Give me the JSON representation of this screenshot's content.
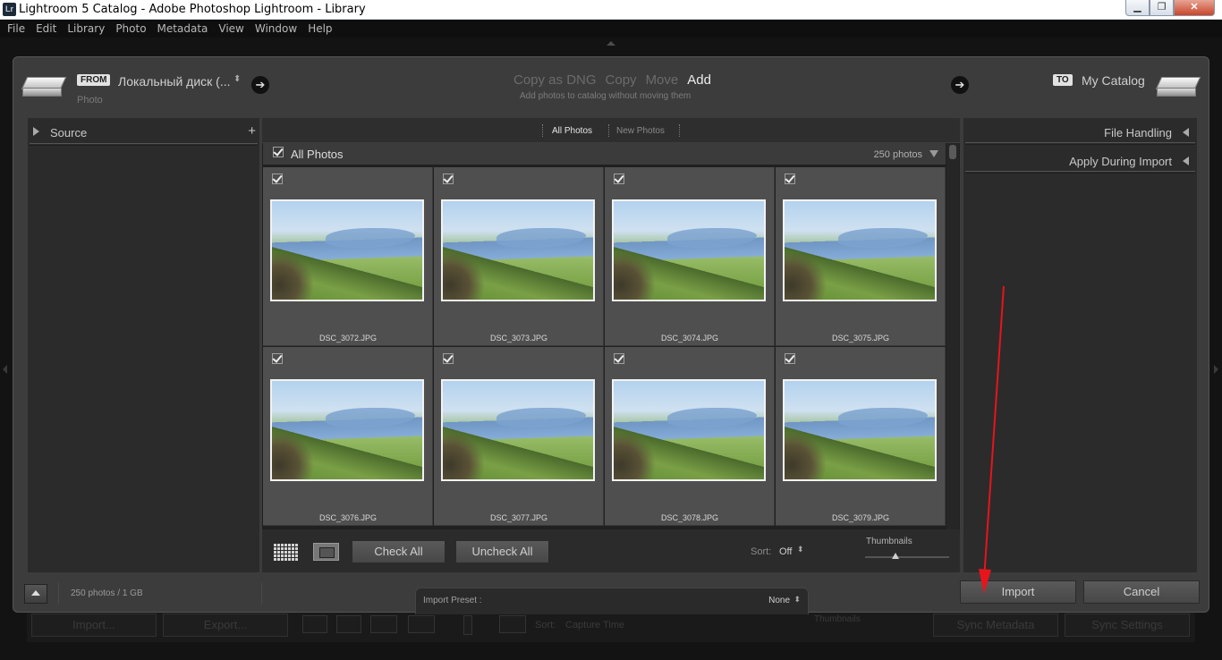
{
  "window": {
    "title": "Lightroom 5 Catalog - Adobe Photoshop Lightroom - Library",
    "app_icon": "Lr",
    "controls": {
      "minimize": "▁",
      "maximize": "❐",
      "close": "✕"
    }
  },
  "menu": [
    "File",
    "Edit",
    "Library",
    "Photo",
    "Metadata",
    "View",
    "Window",
    "Help"
  ],
  "import_dialog": {
    "source": {
      "tag": "FROM",
      "name": "Локальный диск (...",
      "subtitle": "Photo"
    },
    "modes": {
      "copy_as_dng": "Copy as DNG",
      "copy": "Copy",
      "move": "Move",
      "add": "Add",
      "active": "add"
    },
    "mode_description": "Add photos to catalog without moving them",
    "destination": {
      "tag": "TO",
      "name": "My Catalog"
    },
    "left_panel": {
      "source_label": "Source",
      "add_symbol": "+"
    },
    "right_panel": {
      "file_handling": "File Handling",
      "apply_during_import": "Apply During Import"
    },
    "filter": {
      "all_photos": "All Photos",
      "new_photos": "New Photos"
    },
    "grid_header": {
      "label": "All Photos",
      "count": "250 photos"
    },
    "photos": [
      {
        "file": "DSC_3072.JPG",
        "checked": true
      },
      {
        "file": "DSC_3073.JPG",
        "checked": true
      },
      {
        "file": "DSC_3074.JPG",
        "checked": true
      },
      {
        "file": "DSC_3075.JPG",
        "checked": true
      },
      {
        "file": "DSC_3076.JPG",
        "checked": true
      },
      {
        "file": "DSC_3077.JPG",
        "checked": true
      },
      {
        "file": "DSC_3078.JPG",
        "checked": true
      },
      {
        "file": "DSC_3079.JPG",
        "checked": true
      }
    ],
    "toolbar": {
      "check_all": "Check All",
      "uncheck_all": "Uncheck All",
      "sort_label": "Sort:",
      "sort_value": "Off",
      "sort_caret": "⬍",
      "thumbnails_label": "Thumbnails",
      "thumbnail_size": 0.36
    },
    "footer": {
      "info": "250 photos / 1 GB",
      "import_preset_label": "Import Preset :",
      "import_preset_value": "None",
      "preset_caret": "⬍",
      "import_button": "Import",
      "cancel_button": "Cancel"
    }
  },
  "background_bar": {
    "import": "Import...",
    "export": "Export...",
    "sort_label": "Sort:",
    "sort_value": "Capture Time",
    "thumbnails": "Thumbnails",
    "sync_metadata": "Sync Metadata",
    "sync_settings": "Sync Settings"
  },
  "colors": {
    "annotation_arrow": "#e8141c",
    "dialog_bg": "#3c3c3c",
    "panel_bg": "#2b2b2b"
  }
}
